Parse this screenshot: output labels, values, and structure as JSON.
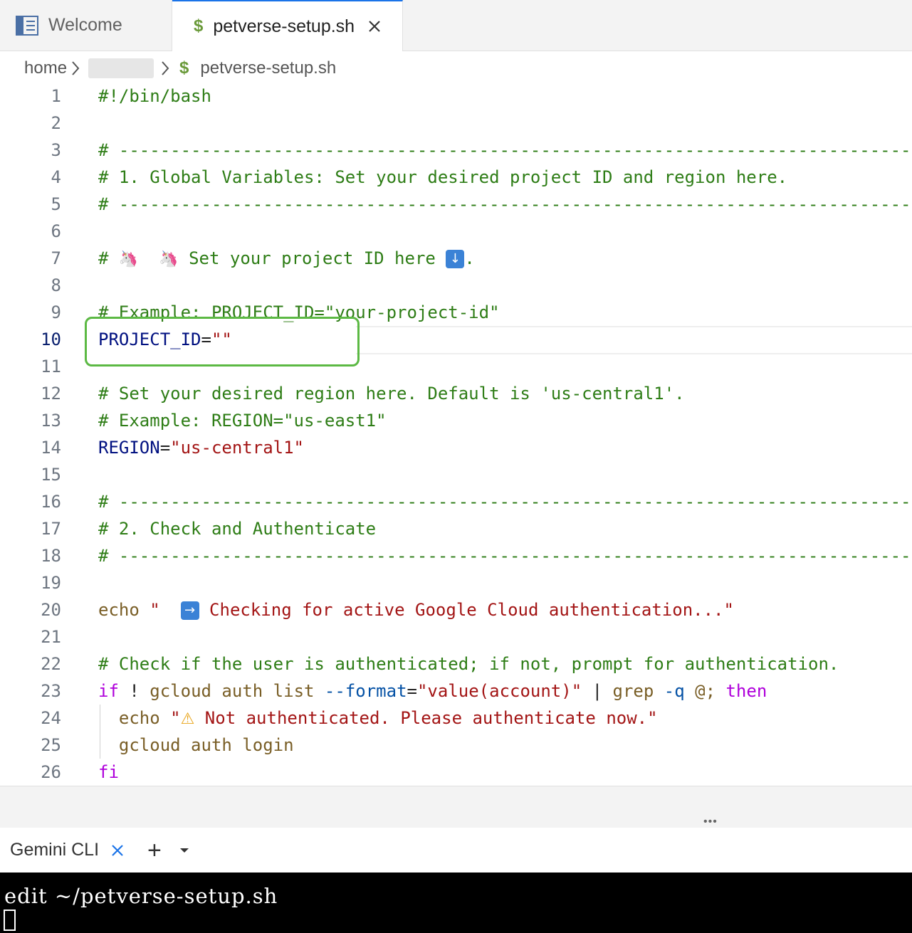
{
  "tabs": [
    {
      "label": "Welcome",
      "icon": "book-icon"
    },
    {
      "label": "petverse-setup.sh",
      "icon": "dollar-icon",
      "active": true
    }
  ],
  "breadcrumb": {
    "root": "home",
    "file": "petverse-setup.sh"
  },
  "editor": {
    "current_line": 10,
    "lines": [
      {
        "n": "1"
      },
      {
        "n": "2"
      },
      {
        "n": "3"
      },
      {
        "n": "4"
      },
      {
        "n": "5"
      },
      {
        "n": "6"
      },
      {
        "n": "7"
      },
      {
        "n": "8"
      },
      {
        "n": "9"
      },
      {
        "n": "10"
      },
      {
        "n": "11"
      },
      {
        "n": "12"
      },
      {
        "n": "13"
      },
      {
        "n": "14"
      },
      {
        "n": "15"
      },
      {
        "n": "16"
      },
      {
        "n": "17"
      },
      {
        "n": "18"
      },
      {
        "n": "19"
      },
      {
        "n": "20"
      },
      {
        "n": "21"
      },
      {
        "n": "22"
      },
      {
        "n": "23"
      },
      {
        "n": "24"
      },
      {
        "n": "25"
      },
      {
        "n": "26"
      }
    ],
    "code": {
      "l1": "#!/bin/bash",
      "l3": "# -----------------------------------------------------------------------------",
      "l4": "# 1. Global Variables: Set your desired project ID and region here.",
      "l5": "# -----------------------------------------------------------------------------",
      "l7a": "# ",
      "l7b": " Set your project ID here ",
      "l7c": ".",
      "l9": "# Example: PROJECT_ID=\"your-project-id\"",
      "l10a": "PROJECT_ID",
      "l10b": "=",
      "l10c": "\"\"",
      "l12": "# Set your desired region here. Default is 'us-central1'.",
      "l13": "# Example: REGION=\"us-east1\"",
      "l14a": "REGION",
      "l14b": "=",
      "l14c": "\"us-central1\"",
      "l16": "# -----------------------------------------------------------------------------",
      "l17": "# 2. Check and Authenticate",
      "l18": "# -----------------------------------------------------------------------------",
      "l20a": "echo",
      "l20b": " \"  ",
      "l20c": " Checking for active Google Cloud authentication...\"",
      "l22": "# Check if the user is authenticated; if not, prompt for authentication.",
      "l23_if": "if",
      "l23_bang": " ! ",
      "l23_gcloud": "gcloud",
      "l23_auth": " auth list ",
      "l23_fmt": "--format",
      "l23_eq": "=",
      "l23_val": "\"value(account)\"",
      "l23_pipe": " | ",
      "l23_grep": "grep",
      "l23_q": " -q",
      "l23_at": " @; ",
      "l23_then": "then",
      "l24a": "  echo",
      "l24b": " \"",
      "l24c": " Not authenticated. Please authenticate now.\"",
      "l25a": "  gcloud",
      "l25b": " auth login",
      "l26": "fi"
    }
  },
  "panel": {
    "overflow_label": "•••"
  },
  "terminal_tab": {
    "label": "Gemini CLI",
    "add_label": "+"
  },
  "terminal": {
    "command": "edit ~/petverse-setup.sh"
  },
  "colors": {
    "accent": "#1a73e8",
    "highlight_box": "#5cb944",
    "comment": "#2e7d16",
    "string": "#a31515"
  }
}
